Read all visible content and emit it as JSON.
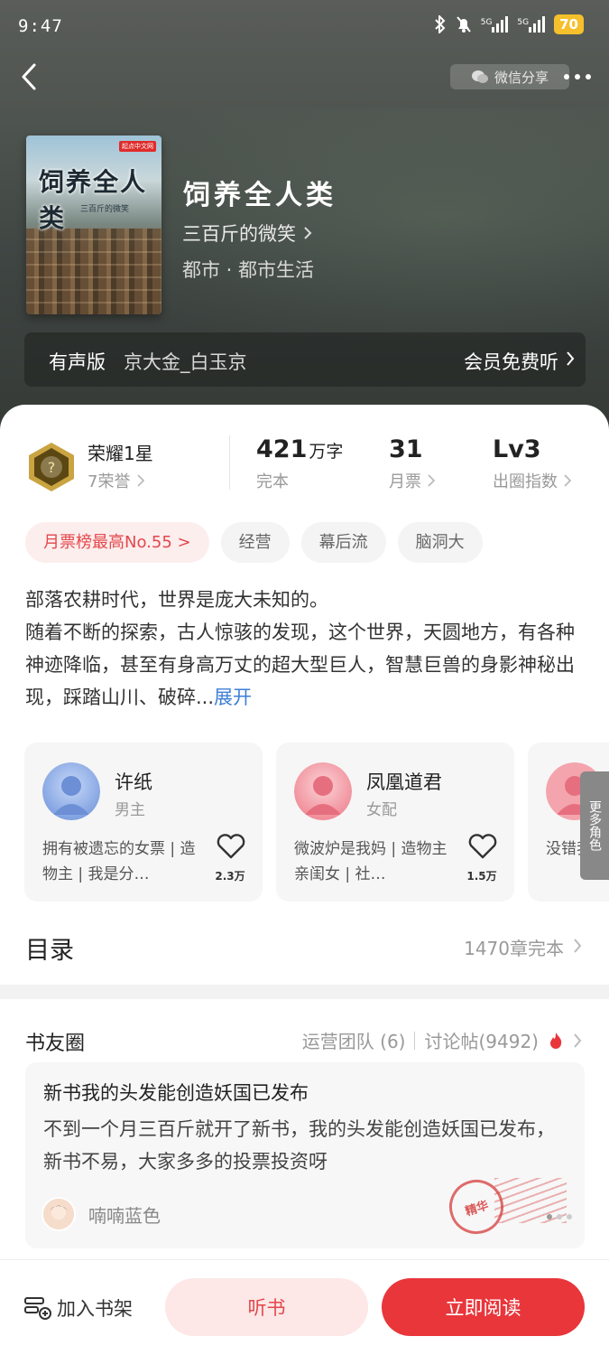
{
  "status_bar": {
    "time": "9:47",
    "battery": "70",
    "net1": "5G",
    "net2": "5G"
  },
  "header": {
    "share_label": "微信分享"
  },
  "book": {
    "cover_title": "饲养全人类",
    "cover_subtitle": "三百斤的微笑",
    "cover_badge": "起点中文网",
    "title": "饲养全人类",
    "author": "三百斤的微笑",
    "genre": "都市 · 都市生活"
  },
  "audio": {
    "label": "有声版",
    "narrator": "京大金_白玉京",
    "free_label": "会员免费听"
  },
  "honor": {
    "title": "荣耀1星",
    "sub": "7荣誉"
  },
  "stats": {
    "words_value": "421",
    "words_unit": "万字",
    "words_label": "完本",
    "votes_value": "31",
    "votes_label": "月票",
    "level_value": "Lv3",
    "level_label": "出圈指数"
  },
  "tags": [
    "月票榜最高No.55 >",
    "经营",
    "幕后流",
    "脑洞大"
  ],
  "intro": {
    "line1": "部落农耕时代，世界是庞大未知的。",
    "line2": "随着不断的探索，古人惊骇的发现，这个世界，天圆地方，有各种神迹降临，甚至有身高万丈的超大型巨人，智慧巨兽的身影神秘出现，踩踏山川、破碎...",
    "expand": "展开"
  },
  "roles": [
    {
      "name": "许纸",
      "tag": "男主",
      "desc": "拥有被遗忘的女票 | 造物主 | 我是分…",
      "count": "2.3万"
    },
    {
      "name": "凤凰道君",
      "tag": "女配",
      "desc": "微波炉是我妈 | 造物主亲闺女 | 社…",
      "count": "1.5万"
    },
    {
      "name": "",
      "tag": "",
      "desc": "没错我就 最强大启",
      "count": ""
    }
  ],
  "more_roles_label": "更多角色",
  "toc": {
    "title": "目录",
    "info": "1470章完本"
  },
  "community": {
    "title": "书友圈",
    "ops_team": "运营团队 (6)",
    "discuss": "讨论帖(9492)",
    "post_title": "新书我的头发能创造妖国已发布",
    "post_body": "不到一个月三百斤就开了新书，我的头发能创造妖国已发布，新书不易，大家多多的投票投资呀",
    "post_user": "喃喃蓝色",
    "stamp": "精华"
  },
  "bottom": {
    "shelf": "加入书架",
    "listen": "听书",
    "read": "立即阅读"
  },
  "colors": {
    "accent": "#e8363b",
    "link": "#3d7fd6",
    "battery": "#f5c02b"
  }
}
